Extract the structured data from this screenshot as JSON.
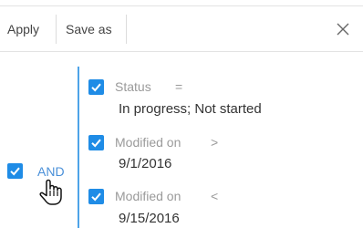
{
  "toolbar": {
    "apply_label": "Apply",
    "save_as_label": "Save as",
    "close_icon": "close-icon"
  },
  "group": {
    "checked": true,
    "operator_label": "AND"
  },
  "conditions": [
    {
      "checked": true,
      "column": "Status",
      "operator": "=",
      "value": "In progress; Not started"
    },
    {
      "checked": true,
      "column": "Modified on",
      "operator": ">",
      "value": "9/1/2016"
    },
    {
      "checked": true,
      "column": "Modified on",
      "operator": "<",
      "value": "9/15/2016"
    }
  ],
  "colors": {
    "checkbox": "#1f8ce6",
    "group_line": "#4ea3e8",
    "link": "#4a90d9"
  }
}
